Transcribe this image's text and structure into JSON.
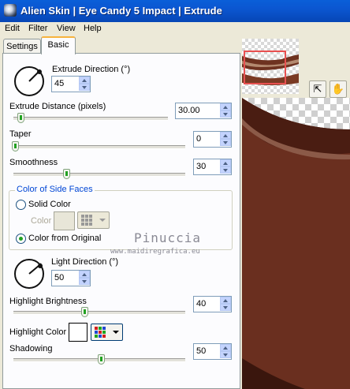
{
  "window": {
    "title": "Alien Skin | Eye Candy 5 Impact | Extrude"
  },
  "menu": [
    "Edit",
    "Filter",
    "View",
    "Help"
  ],
  "tabs": [
    {
      "label": "Settings",
      "active": false
    },
    {
      "label": "Basic",
      "active": true
    }
  ],
  "basic": {
    "extrude_direction": {
      "label": "Extrude Direction (°)",
      "value": "45"
    },
    "extrude_distance": {
      "label": "Extrude Distance (pixels)",
      "value": "30.00",
      "level": 0.05
    },
    "taper": {
      "label": "Taper",
      "value": "0",
      "level": 0.0
    },
    "smoothness": {
      "label": "Smoothness",
      "value": "30",
      "level": 0.3
    },
    "side_faces": {
      "title": "Color of Side Faces",
      "solid_color": "Solid Color",
      "color_label": "Color",
      "from_original": "Color from Original",
      "selected": "from_original",
      "solid_swatch": "#e8e6d8"
    },
    "light_direction": {
      "label": "Light Direction (°)",
      "value": "50"
    },
    "highlight_brightness": {
      "label": "Highlight Brightness",
      "value": "40",
      "level": 0.4
    },
    "highlight_color": {
      "label": "Highlight Color",
      "swatch": "#ffffff"
    },
    "shadowing": {
      "label": "Shadowing",
      "value": "50",
      "level": 0.5
    }
  },
  "watermark": {
    "name": "Pinuccia",
    "url": "www.maidiregrafica.eu"
  },
  "icons": {
    "tool1": "hand-pointer-icon",
    "tool2": "hand-pan-icon"
  }
}
